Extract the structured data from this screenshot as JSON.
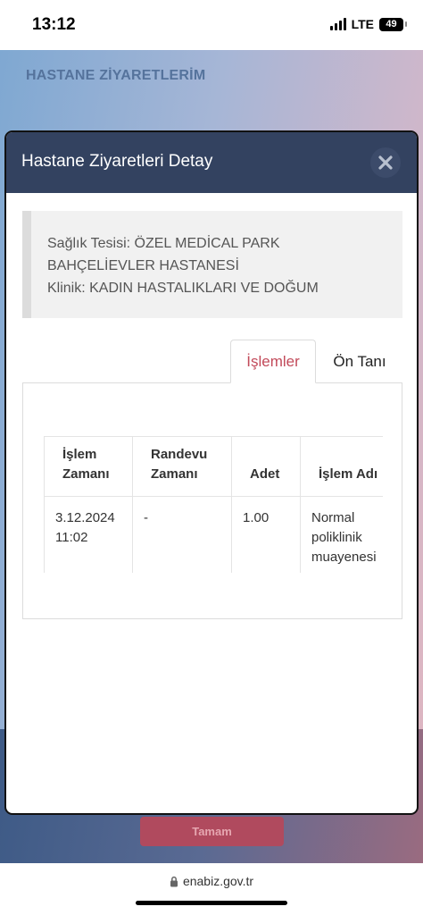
{
  "status_bar": {
    "time": "13:12",
    "network": "LTE",
    "battery": "49"
  },
  "background": {
    "page_title": "HASTANE ZİYARETLERİM",
    "button_label": "Tamam"
  },
  "modal": {
    "title": "Hastane Ziyaretleri Detay",
    "close_icon": "close-icon",
    "info": {
      "line1": "Sağlık Tesisi: ÖZEL MEDİCAL PARK",
      "line2": "BAHÇELİEVLER HASTANESİ",
      "line3": "Klinik: KADIN HASTALIKLARI VE DOĞUM"
    },
    "tabs": [
      {
        "label": "İşlemler",
        "active": true
      },
      {
        "label": "Ön Tanı",
        "active": false
      }
    ],
    "table": {
      "headers": [
        "İşlem Zamanı",
        "Randevu Zamanı",
        "Adet",
        "İşlem Adı"
      ],
      "rows": [
        {
          "islem_zamani": "3.12.2024 11:02",
          "randevu_zamani": "-",
          "adet": "1.00",
          "islem_adi": "Normal poliklinik muayenesi"
        }
      ]
    }
  },
  "browser": {
    "url": "enabiz.gov.tr",
    "lock_icon": "lock-icon"
  },
  "colors": {
    "modal_header": "#334260",
    "active_tab": "#c24a5a",
    "bg_button": "#b04a5e"
  }
}
